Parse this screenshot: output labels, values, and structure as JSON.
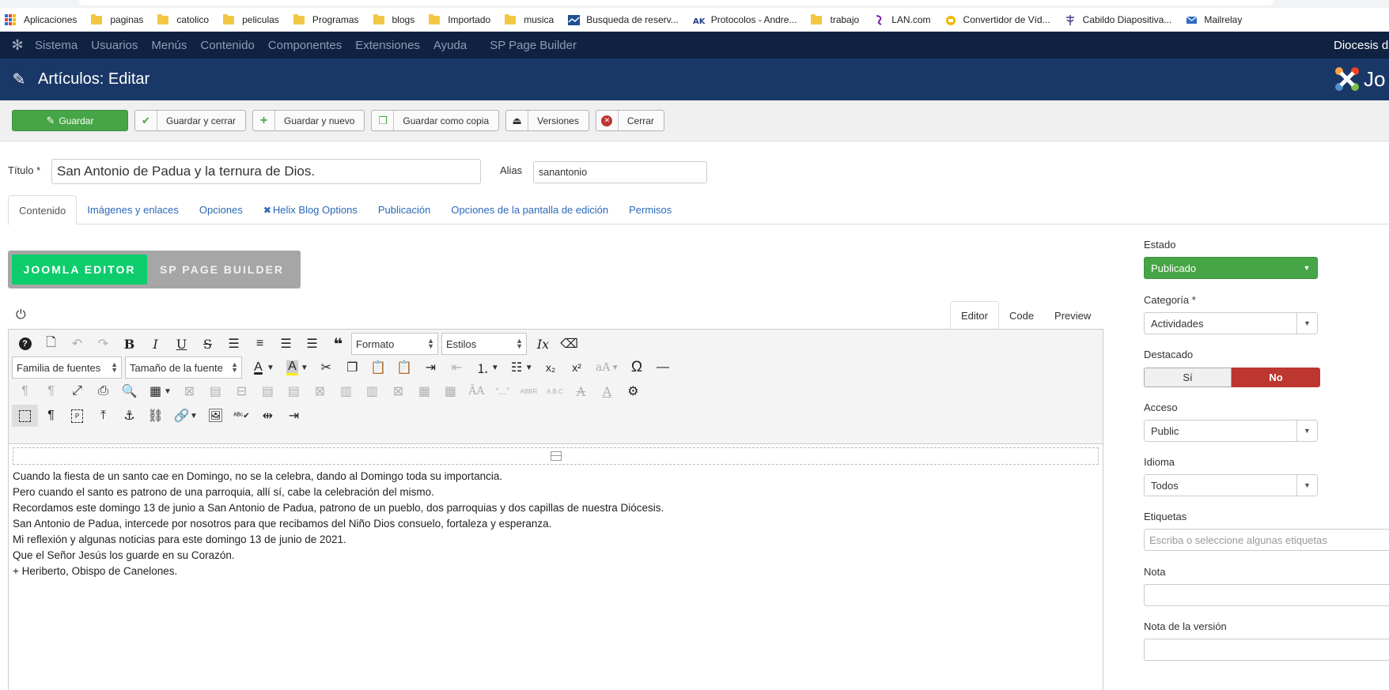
{
  "bookmarks": [
    {
      "label": "Aplicaciones",
      "icon": "apps-grid-icon"
    },
    {
      "label": "paginas",
      "icon": "folder-icon"
    },
    {
      "label": "catolico",
      "icon": "folder-icon"
    },
    {
      "label": "peliculas",
      "icon": "folder-icon"
    },
    {
      "label": "Programas",
      "icon": "folder-icon"
    },
    {
      "label": "blogs",
      "icon": "folder-icon"
    },
    {
      "label": "Importado",
      "icon": "folder-icon"
    },
    {
      "label": "musica",
      "icon": "folder-icon"
    },
    {
      "label": "Busqueda de reserv...",
      "icon": "site-favicon"
    },
    {
      "label": "Protocolos - Andre...",
      "icon": "site-favicon"
    },
    {
      "label": "trabajo",
      "icon": "folder-icon"
    },
    {
      "label": "LAN.com",
      "icon": "site-favicon"
    },
    {
      "label": "Convertidor de Víd...",
      "icon": "site-favicon"
    },
    {
      "label": "Cabildo Diapositiva...",
      "icon": "site-favicon"
    },
    {
      "label": "Mailrelay",
      "icon": "site-favicon"
    }
  ],
  "adminmenu": {
    "items": [
      "Sistema",
      "Usuarios",
      "Menús",
      "Contenido",
      "Componentes",
      "Extensiones",
      "Ayuda"
    ],
    "extra": "SP Page Builder",
    "site": "Diocesis d"
  },
  "header": {
    "title": "Artículos: Editar",
    "brand": "Jo"
  },
  "toolbar": {
    "save": "Guardar",
    "save_close": "Guardar y cerrar",
    "save_new": "Guardar y nuevo",
    "save_copy": "Guardar como copia",
    "versions": "Versiones",
    "close": "Cerrar"
  },
  "form": {
    "title_label": "Título *",
    "title_value": "San Antonio de Padua y la ternura de Dios.",
    "alias_label": "Alias",
    "alias_value": "sanantonio"
  },
  "tabs": [
    "Contenido",
    "Imágenes y enlaces",
    "Opciones",
    "Helix Blog Options",
    "Publicación",
    "Opciones de la pantalla de edición",
    "Permisos"
  ],
  "switcher": {
    "on": "JOOMLA EDITOR",
    "off": "SP PAGE BUILDER"
  },
  "editor_tabs": [
    "Editor",
    "Code",
    "Preview"
  ],
  "editor_selects": {
    "format": "Formato",
    "styles": "Estilos",
    "font_family": "Familia de fuentes",
    "font_size": "Tamaño de la fuente"
  },
  "content_lines": [
    "Cuando la fiesta de un santo cae en Domingo, no se la celebra, dando al Domingo toda su importancia.",
    "Pero cuando el santo es patrono de una parroquia, allí sí, cabe la celebración del mismo.",
    "Recordamos este domingo 13 de junio a San Antonio de Padua, patrono de un pueblo, dos parroquias y dos capillas de nuestra Diócesis.",
    "San Antonio de Padua, intercede por nosotros para que recibamos del Niño Dios consuelo, fortaleza y esperanza.",
    "Mi reflexión y algunas noticias para este domingo 13 de junio de 2021.",
    "Que el Señor Jesús los guarde en su Corazón.",
    "+ Heriberto, Obispo de Canelones."
  ],
  "sidebar": {
    "estado_label": "Estado",
    "estado_value": "Publicado",
    "categoria_label": "Categoría *",
    "categoria_value": "Actividades",
    "destacado_label": "Destacado",
    "destacado_si": "Sí",
    "destacado_no": "No",
    "acceso_label": "Acceso",
    "acceso_value": "Public",
    "idioma_label": "Idioma",
    "idioma_value": "Todos",
    "etiquetas_label": "Etiquetas",
    "etiquetas_placeholder": "Escriba o seleccione algunas etiquetas",
    "nota_label": "Nota",
    "nota_version_label": "Nota de la versión"
  },
  "colors": {
    "admin_bar": "#102241",
    "header": "#1a3867",
    "success": "#46a546",
    "danger": "#bd362f",
    "switch_on": "#0dcc6c"
  }
}
